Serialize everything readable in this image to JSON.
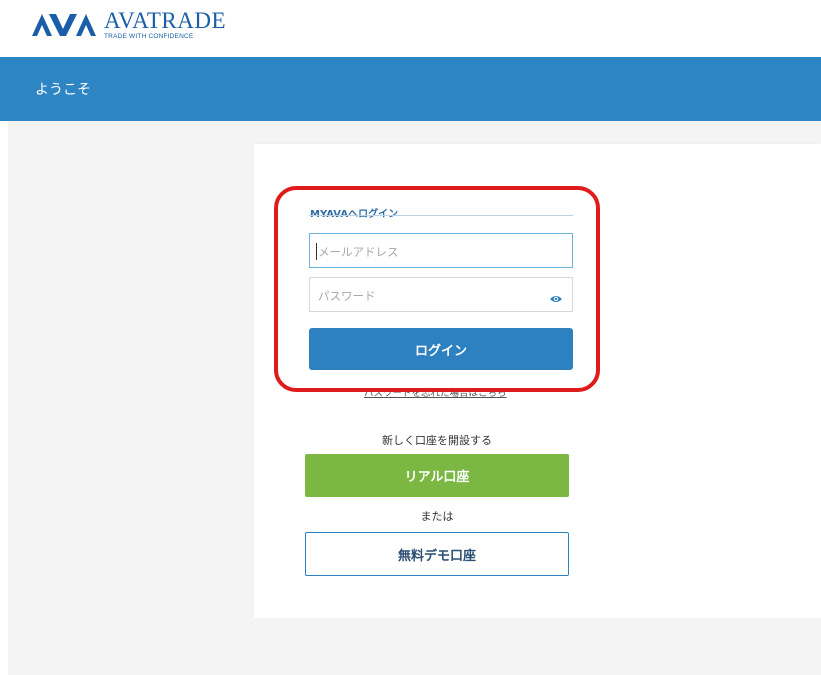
{
  "brand": {
    "name": "AVATRADE",
    "tagline": "TRADE WITH CONFIDENCE",
    "color": "#1a5da8"
  },
  "header": {
    "welcome": "ようこそ",
    "bar_color": "#2e85c4"
  },
  "login": {
    "title": "MYAVAへログイン",
    "email_placeholder": "メールアドレス",
    "password_placeholder": "パスワード",
    "show_password_icon": "eye-icon",
    "submit_label": "ログイン",
    "forgot_link": "パスワードを忘れた場合はこちら"
  },
  "register": {
    "prompt": "新しく口座を開設する",
    "real_label": "リアル口座",
    "or_text": "または",
    "demo_label": "無料デモ口座",
    "real_color": "#7ab843"
  },
  "highlight_color": "#e01b1b"
}
